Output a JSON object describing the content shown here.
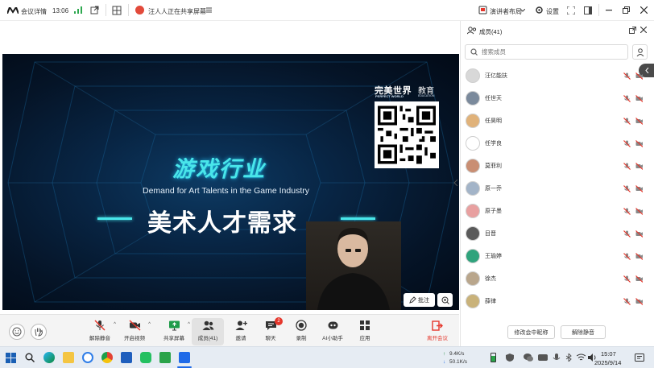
{
  "titlebar": {
    "app_name": "会议详情",
    "time": "13:06",
    "sharing_notice": "汪人人正在共享屏幕",
    "speaker_layout": "演讲者布局",
    "settings": "设置"
  },
  "slide": {
    "brand_cn": "完美世界",
    "brand_edu": "教育",
    "brand_en": "PERFECT WORLD",
    "brand_en_sub": "EDUCATION",
    "headline": "游戏行业",
    "subtitle_en": "Demand for Art Talents in the Game Industry",
    "main_title": "美术人才需求"
  },
  "annotate_label": "批注",
  "panel": {
    "title": "成员(41)",
    "search_placeholder": "搜索成员",
    "members": [
      {
        "name": "汪亿能扶",
        "color": "#d8d8d8"
      },
      {
        "name": "任世天",
        "color": "#7b8a9c"
      },
      {
        "name": "任昊明",
        "color": "#e0b27a"
      },
      {
        "name": "任学良",
        "color": "#ffffff"
      },
      {
        "name": "莫菲利",
        "color": "#c98e73"
      },
      {
        "name": "原一乔",
        "color": "#a3b4c8"
      },
      {
        "name": "原子墨",
        "color": "#e8a0a0"
      },
      {
        "name": "目晋",
        "color": "#5a5a5a"
      },
      {
        "name": "王瑜婷",
        "color": "#2fa37c"
      },
      {
        "name": "徐杰",
        "color": "#b9a68c"
      },
      {
        "name": "薛律",
        "color": "#c9b27a"
      }
    ],
    "footer_buttons": [
      "修改会中昵称",
      "解除静音"
    ]
  },
  "toolbar": {
    "items": [
      {
        "label": "解除静音",
        "icon": "mic-muted-icon"
      },
      {
        "label": "开启视频",
        "icon": "video-off-icon"
      },
      {
        "label": "共享屏幕",
        "icon": "share-screen-icon"
      },
      {
        "label": "成员(41)",
        "icon": "members-icon"
      },
      {
        "label": "邀请",
        "icon": "invite-icon"
      },
      {
        "label": "聊天",
        "icon": "chat-icon",
        "badge": "2"
      },
      {
        "label": "录制",
        "icon": "record-icon"
      },
      {
        "label": "AI小助手",
        "icon": "ai-assistant-icon"
      },
      {
        "label": "应用",
        "icon": "apps-icon"
      }
    ],
    "leave": "离开会议"
  },
  "taskbar": {
    "net_up": "9.4K/s",
    "net_down": "50.1K/s",
    "clock_time": "15:07",
    "clock_date": "2025/9/14"
  },
  "colors": {
    "accent_blue": "#1f6ae8",
    "leave_red": "#e5362b",
    "slide_cyan": "#49e6ea"
  }
}
